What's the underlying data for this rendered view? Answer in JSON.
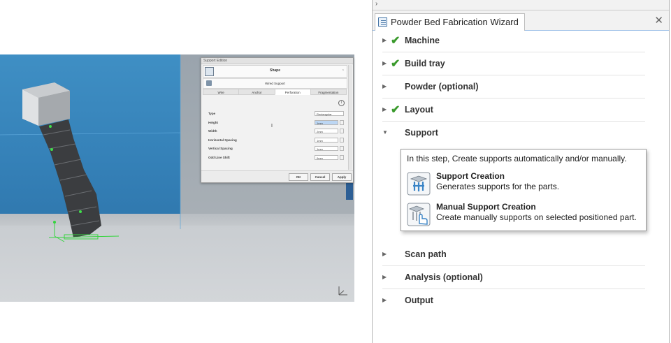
{
  "dialog": {
    "title": "Support Edition",
    "shape_label": "Shape",
    "wired_label": "Wired Support",
    "tabs": [
      "Wire",
      "Anchor",
      "Perforation",
      "Fragmentation"
    ],
    "active_tab": 2,
    "rows": [
      {
        "label": "Type",
        "value": "Rectangular"
      },
      {
        "label": "Height",
        "value": "1mm"
      },
      {
        "label": "Width",
        "value": "2mm"
      },
      {
        "label": "Horizontal Spacing",
        "value": "1mm"
      },
      {
        "label": "Vertical Spacing",
        "value": "1mm"
      },
      {
        "label": "Odd Line Shift",
        "value": "0mm"
      }
    ],
    "buttons": {
      "ok": "OK",
      "cancel": "Cancel",
      "apply": "Apply"
    }
  },
  "wizard": {
    "tab_title": "Powder Bed Fabrication Wizard",
    "close_glyph": "✕",
    "strip_glyph": "›",
    "steps": [
      {
        "label": "Machine",
        "completed": true,
        "expanded": false
      },
      {
        "label": "Build tray",
        "completed": true,
        "expanded": false
      },
      {
        "label": "Powder (optional)",
        "completed": false,
        "expanded": false
      },
      {
        "label": "Layout",
        "completed": true,
        "expanded": false
      },
      {
        "label": "Support",
        "completed": false,
        "expanded": true
      },
      {
        "label": "Scan path",
        "completed": false,
        "expanded": false
      },
      {
        "label": "Analysis (optional)",
        "completed": false,
        "expanded": false
      },
      {
        "label": "Output",
        "completed": false,
        "expanded": false
      }
    ],
    "tooltip": {
      "intro": "In this step, Create supports automatically and/or manually.",
      "items": [
        {
          "title": "Support Creation",
          "desc": "Generates supports for the parts.",
          "icon": "support-creation-icon"
        },
        {
          "title": "Manual Support Creation",
          "desc": "Create manually supports on selected positioned part.",
          "icon": "manual-support-creation-icon"
        }
      ]
    },
    "check_glyph": "✔",
    "collapsed_glyph": "▶",
    "expanded_glyph": "▼"
  },
  "colors": {
    "check": "#3a9a2c",
    "wall": "#3581b8",
    "accent": "#9ec1e8"
  }
}
